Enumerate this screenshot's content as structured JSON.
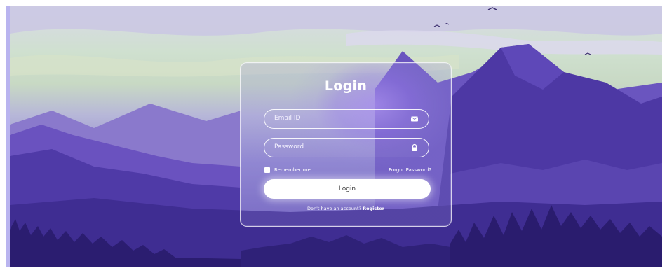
{
  "login": {
    "title": "Login",
    "email_placeholder": "Email ID",
    "password_placeholder": "Password",
    "remember_label": "Remember me",
    "forgot_label": "Forgot Password?",
    "login_button": "Login",
    "register_prompt": "Don't have an account?",
    "register_link": "Register"
  },
  "icons": {
    "email": "envelope-icon",
    "password": "lock-icon"
  },
  "colors": {
    "accent_purple": "#5c48b1",
    "card_glow": "#9b87e6",
    "button_bg": "#ffffff"
  }
}
